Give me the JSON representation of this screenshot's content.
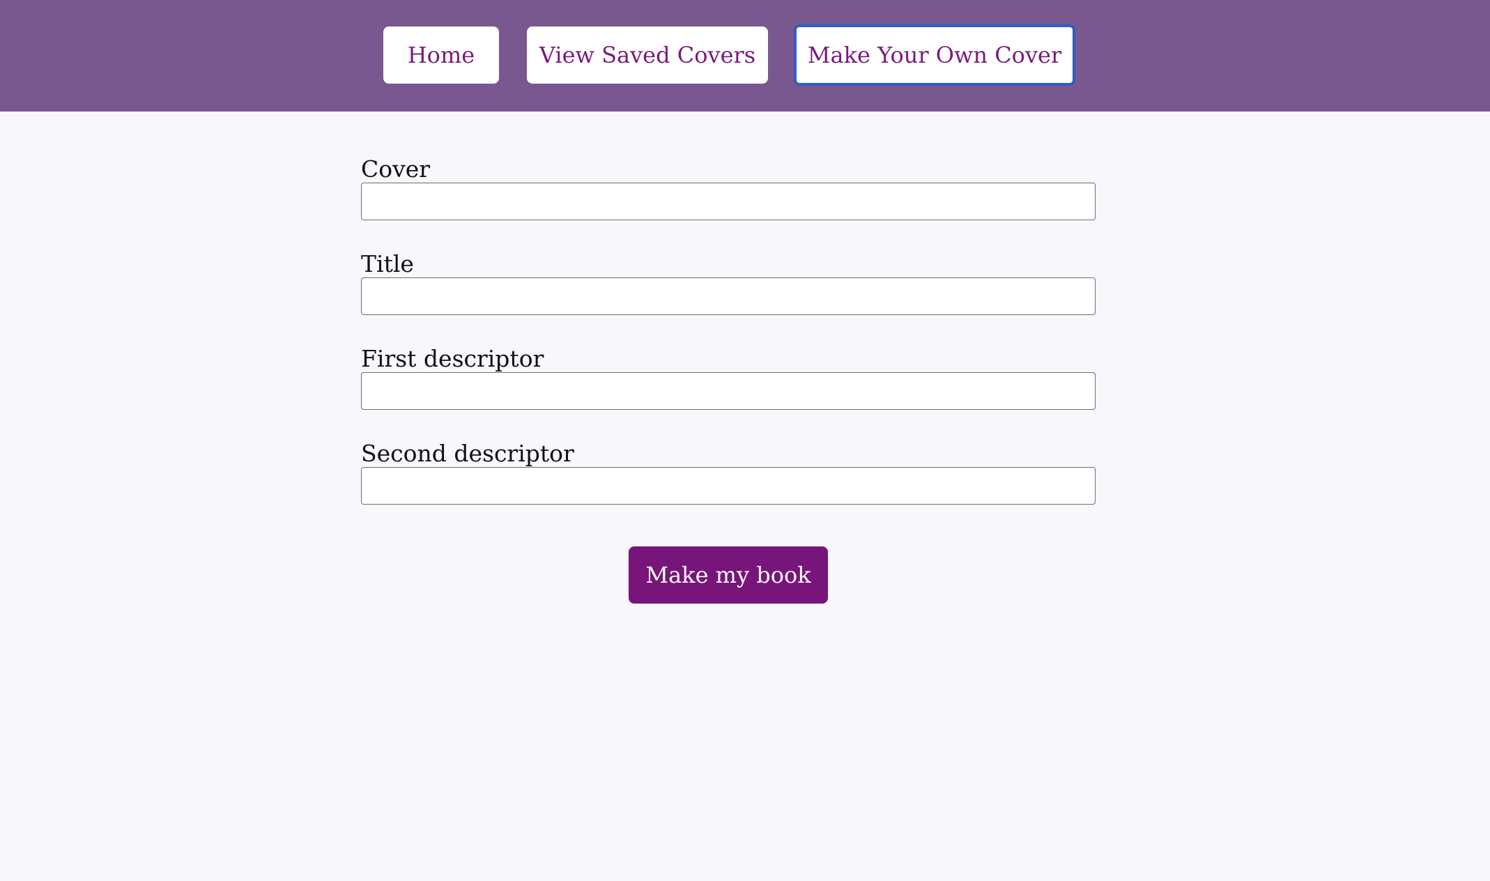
{
  "nav": {
    "home_label": "Home",
    "saved_label": "View Saved Covers",
    "make_label": "Make Your Own Cover"
  },
  "form": {
    "fields": [
      {
        "label": "Cover",
        "value": ""
      },
      {
        "label": "Title",
        "value": ""
      },
      {
        "label": "First descriptor",
        "value": ""
      },
      {
        "label": "Second descriptor",
        "value": ""
      }
    ],
    "submit_label": "Make my book"
  },
  "colors": {
    "header_bg": "#79578f",
    "page_bg": "#f7f7fc",
    "accent": "#78157a",
    "focus_ring": "#2f5fbf"
  }
}
